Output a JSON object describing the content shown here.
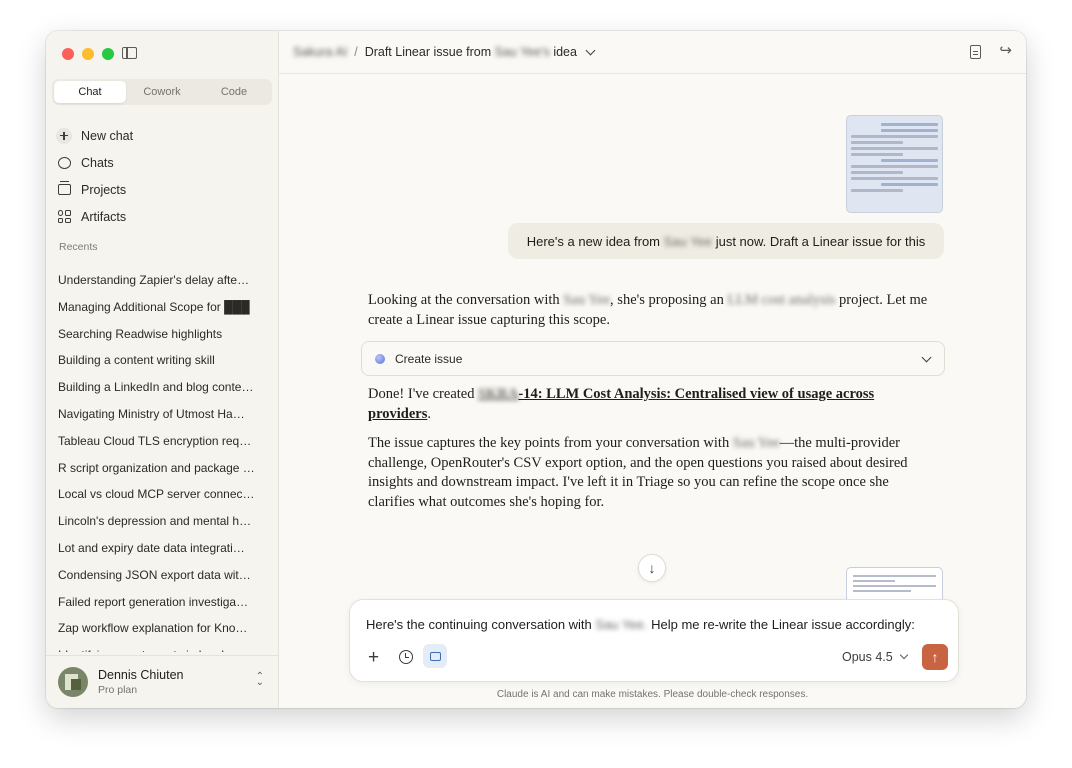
{
  "window": {
    "traffic_lights": {
      "close": "#fe5f57",
      "minimize": "#febc2e",
      "zoom": "#28c840"
    }
  },
  "sidebar": {
    "mode_tabs": [
      {
        "label": "Chat",
        "active": true
      },
      {
        "label": "Cowork",
        "active": false
      },
      {
        "label": "Code",
        "active": false
      }
    ],
    "nav": [
      {
        "label": "New chat",
        "icon": "plus-circle-icon"
      },
      {
        "label": "Chats",
        "icon": "chat-bubble-icon"
      },
      {
        "label": "Projects",
        "icon": "projects-icon"
      },
      {
        "label": "Artifacts",
        "icon": "artifacts-icon"
      }
    ],
    "recents_label": "Recents",
    "recents": [
      "Understanding Zapier's delay afte…",
      "Managing Additional Scope for ███",
      "Searching Readwise highlights",
      "Building a content writing skill",
      "Building a LinkedIn and blog conte…",
      "Navigating Ministry of Utmost Ha…",
      "Tableau Cloud TLS encryption req…",
      "R script organization and package …",
      "Local vs cloud MCP server connec…",
      "Lincoln's depression and mental h…",
      "Lot and expiry date data integrati…",
      "Condensing JSON export data wit…",
      "Failed report generation investiga…",
      "Zap workflow explanation for Kno…",
      "Identifying counterparty in legal a…"
    ],
    "user": {
      "name": "Dennis Chiuten",
      "plan": "Pro plan"
    }
  },
  "topbar": {
    "project": "Sakura AI",
    "separator": "/",
    "title_prefix": "Draft Linear issue from",
    "title_redacted": "Sau Yee's",
    "title_suffix": "idea"
  },
  "conversation": {
    "user_message": {
      "prefix": "Here's a new idea from",
      "redacted": "Sau Yee",
      "suffix": "just now. Draft a Linear issue for this"
    },
    "assistant_intro": {
      "p1": "Looking at the conversation with",
      "r1": "Sau Yee",
      "p2": ", she's proposing an",
      "r2": "LLM cost analysis",
      "p3": "project. Let me create a Linear issue capturing this scope."
    },
    "tool_call": {
      "label": "Create issue",
      "icon": "linear-dot-icon"
    },
    "done": {
      "prefix": "Done! I've created",
      "redacted": "SKRA",
      "link": "-14: LLM Cost Analysis: Centralised view of usage across providers",
      "suffix": "."
    },
    "summary": {
      "p1": "The issue captures the key points from your conversation with",
      "r1": "Sau Yee",
      "p2": "—the multi-provider challenge, OpenRouter's CSV export option, and the open questions you raised about desired insights and downstream impact. I've left it in Triage so you can refine the scope once she clarifies what outcomes she's hoping for."
    }
  },
  "composer": {
    "text_prefix": "Here's the continuing conversation with",
    "text_redacted": "Sau Yee.",
    "text_suffix": "Help me re-write the Linear issue accordingly:",
    "model": "Opus 4.5",
    "send_color": "#c96442"
  },
  "disclaimer": "Claude is AI and can make mistakes. Please double-check responses."
}
